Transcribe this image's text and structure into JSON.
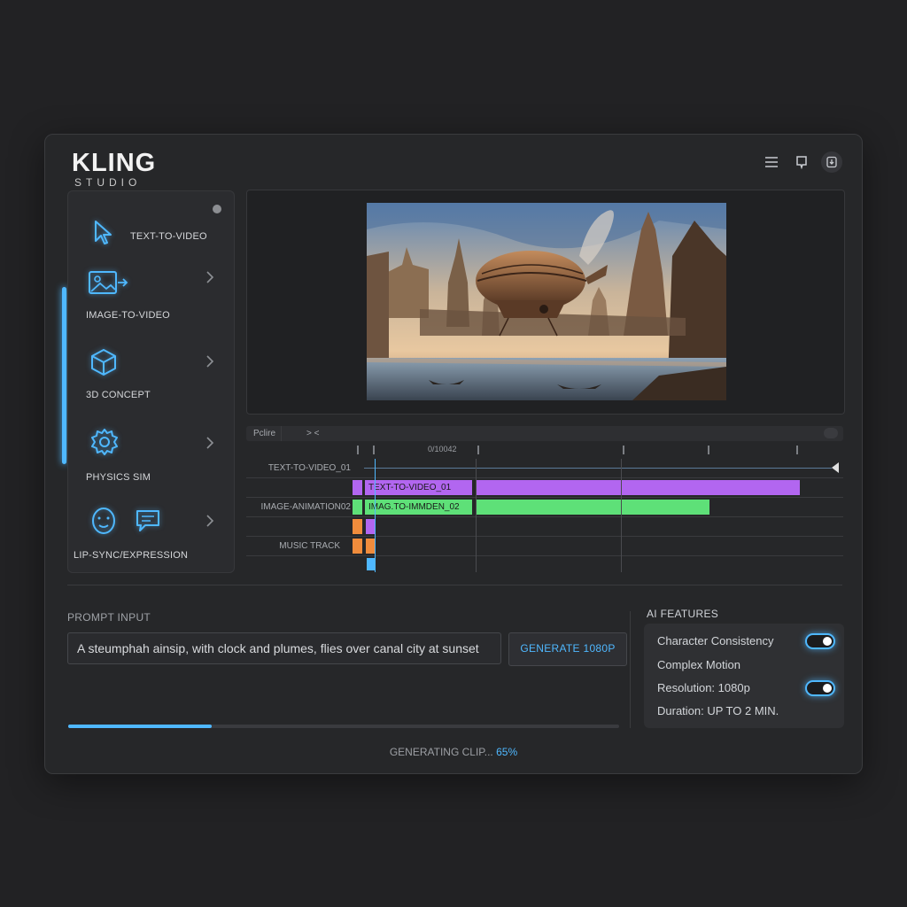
{
  "brand": {
    "name": "KLING",
    "sub": "STUDIO"
  },
  "sidebar": {
    "items": [
      {
        "label": "TEXT-TO-VIDEO"
      },
      {
        "label": "IMAGE-TO-VIDEO"
      },
      {
        "label": "3D CONCEPT"
      },
      {
        "label": "PHYSICS SIM"
      },
      {
        "label": "LIP-SYNC/EXPRESSION"
      }
    ]
  },
  "timeline": {
    "toolbar": {
      "left_button": "Pclire",
      "nav": "> <"
    },
    "timecode": "0/10042",
    "tracks": [
      {
        "label": "TEXT-TO-VIDEO_01"
      },
      {
        "label": ""
      },
      {
        "label": "IMAGE-ANIMATION02"
      },
      {
        "label": ""
      },
      {
        "label": "MUSIC TRACK"
      }
    ],
    "clips": {
      "video_clip": "TEXT-TO-VIDEO_01",
      "image_clip": "IMAG.TO-IMMDEN_02"
    }
  },
  "prompt": {
    "label": "PROMPT INPUT",
    "value": "A steumphah ainsip, with clock and plumes, flies over canal city at sunset",
    "button": "GENERATE 1080P"
  },
  "ai_features": {
    "title": "AI FEATURES",
    "items": [
      {
        "label": "Character Consistency",
        "toggle": true
      },
      {
        "label": "Complex Motion",
        "toggle": false
      },
      {
        "label": "Resolution: 1080p",
        "toggle": true
      },
      {
        "label": "Duration: UP TO 2 MIN.",
        "toggle": false
      }
    ]
  },
  "status": {
    "text": "GENERATING CLIP...",
    "percent_label": "65%",
    "progress": 0.26
  },
  "colors": {
    "accent": "#4fb8ff",
    "purple": "#b266f0",
    "green": "#5ee078",
    "orange": "#f08c3c"
  }
}
